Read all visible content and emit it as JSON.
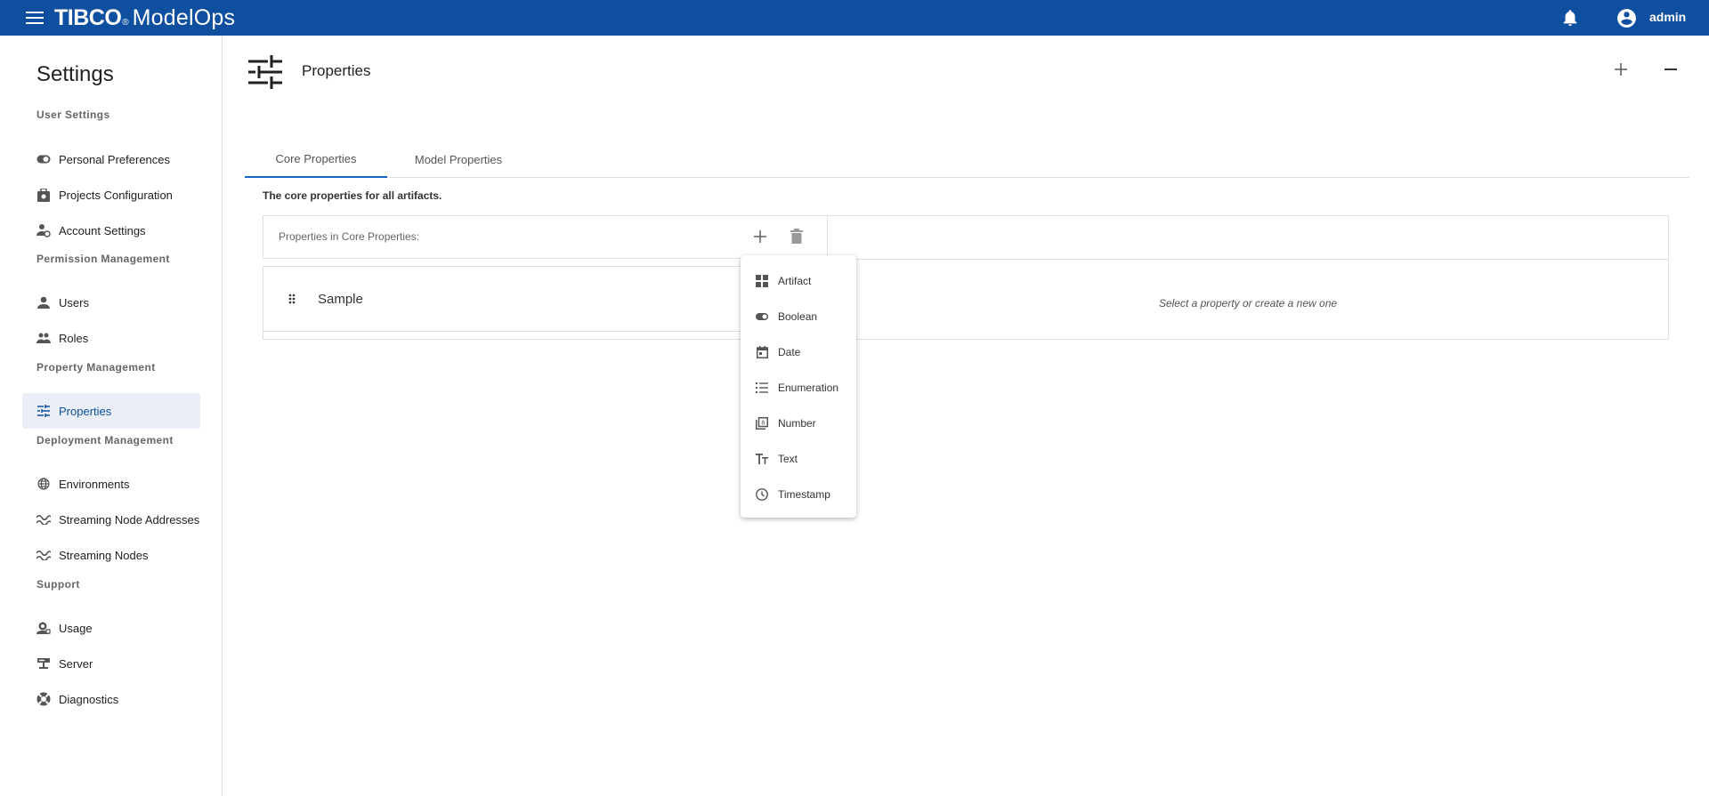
{
  "app": {
    "brand_company": "TIBCO",
    "brand_mark": "®",
    "brand_product": "ModelOps",
    "username": "admin",
    "header_color": "#0f4fa0"
  },
  "sidebar": {
    "title": "Settings",
    "sections": [
      {
        "label": "User Settings",
        "items": [
          {
            "label": "Personal Preferences",
            "icon": "toggle-icon"
          },
          {
            "label": "Projects Configuration",
            "icon": "project-icon"
          },
          {
            "label": "Account Settings",
            "icon": "account-icon"
          }
        ]
      },
      {
        "label": "Permission Management",
        "items": [
          {
            "label": "Users",
            "icon": "user-icon"
          },
          {
            "label": "Roles",
            "icon": "group-icon"
          }
        ]
      },
      {
        "label": "Property Management",
        "items": [
          {
            "label": "Properties",
            "icon": "sliders-icon",
            "active": true
          }
        ]
      },
      {
        "label": "Deployment Management",
        "items": [
          {
            "label": "Environments",
            "icon": "globe-icon"
          },
          {
            "label": "Streaming Node Addresses",
            "icon": "wave-icon"
          },
          {
            "label": "Streaming Nodes",
            "icon": "wave-icon"
          }
        ]
      },
      {
        "label": "Support",
        "items": [
          {
            "label": "Usage",
            "icon": "usage-icon"
          },
          {
            "label": "Server",
            "icon": "server-icon"
          },
          {
            "label": "Diagnostics",
            "icon": "diagnostics-icon"
          }
        ]
      }
    ]
  },
  "main": {
    "title": "Properties",
    "tabs": [
      {
        "label": "Core Properties",
        "active": true
      },
      {
        "label": "Model Properties",
        "active": false
      }
    ],
    "description": "The core properties for all artifacts.",
    "list_header": "Properties in Core Properties:",
    "list_items": [
      {
        "label": "Sample"
      }
    ],
    "empty_message": "Select a property or create a new one"
  },
  "add_menu": {
    "items": [
      {
        "label": "Artifact",
        "icon": "artifact-icon"
      },
      {
        "label": "Boolean",
        "icon": "toggle-icon"
      },
      {
        "label": "Date",
        "icon": "calendar-icon"
      },
      {
        "label": "Enumeration",
        "icon": "list-icon"
      },
      {
        "label": "Number",
        "icon": "number-icon"
      },
      {
        "label": "Text",
        "icon": "text-icon"
      },
      {
        "label": "Timestamp",
        "icon": "clock-icon"
      }
    ]
  }
}
